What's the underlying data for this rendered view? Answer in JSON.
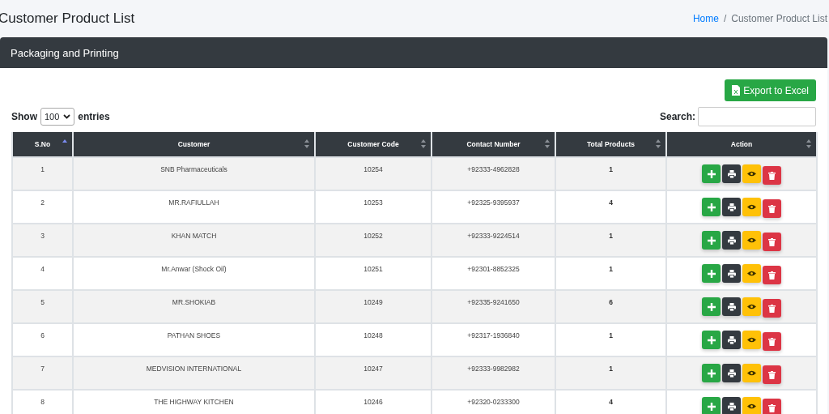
{
  "page_title": "Customer Product List",
  "breadcrumb_separator": "/",
  "breadcrumb": [
    {
      "label": "Home",
      "kind": "link"
    },
    {
      "label": "Customer Product List",
      "kind": "current"
    }
  ],
  "card": {
    "title": "Packaging and Printing"
  },
  "export_button": {
    "label": "Export to Excel"
  },
  "length_control": {
    "before": "Show",
    "value": "100",
    "after": "entries"
  },
  "search": {
    "label": "Search:"
  },
  "table": {
    "columns": [
      {
        "label": "S.No",
        "sorted": true
      },
      {
        "label": "Customer",
        "sorted": false
      },
      {
        "label": "Customer Code",
        "sorted": false
      },
      {
        "label": "Contact Number",
        "sorted": false
      },
      {
        "label": "Total Products",
        "sorted": false
      },
      {
        "label": "Action",
        "sorted": false
      }
    ],
    "rows": [
      {
        "sno": "1",
        "customer": "SNB Pharmaceuticals",
        "code": "10254",
        "contact": "+92333-4962828",
        "total": "1"
      },
      {
        "sno": "2",
        "customer": "MR.RAFIULLAH",
        "code": "10253",
        "contact": "+92325-9395937",
        "total": "4"
      },
      {
        "sno": "3",
        "customer": "KHAN MATCH",
        "code": "10252",
        "contact": "+92333-9224514",
        "total": "1"
      },
      {
        "sno": "4",
        "customer": "Mr.Anwar (Shock Oil)",
        "code": "10251",
        "contact": "+92301-8852325",
        "total": "1"
      },
      {
        "sno": "5",
        "customer": "MR.SHOKIAB",
        "code": "10249",
        "contact": "+92335-9241650",
        "total": "6"
      },
      {
        "sno": "6",
        "customer": "PATHAN SHOES",
        "code": "10248",
        "contact": "+92317-1936840",
        "total": "1"
      },
      {
        "sno": "7",
        "customer": "MEDVISION INTERNATIONAL",
        "code": "10247",
        "contact": "+92333-9982982",
        "total": "1"
      },
      {
        "sno": "8",
        "customer": "THE HIGHWAY KITCHEN",
        "code": "10246",
        "contact": "+92320-0233300",
        "total": "4"
      }
    ]
  }
}
